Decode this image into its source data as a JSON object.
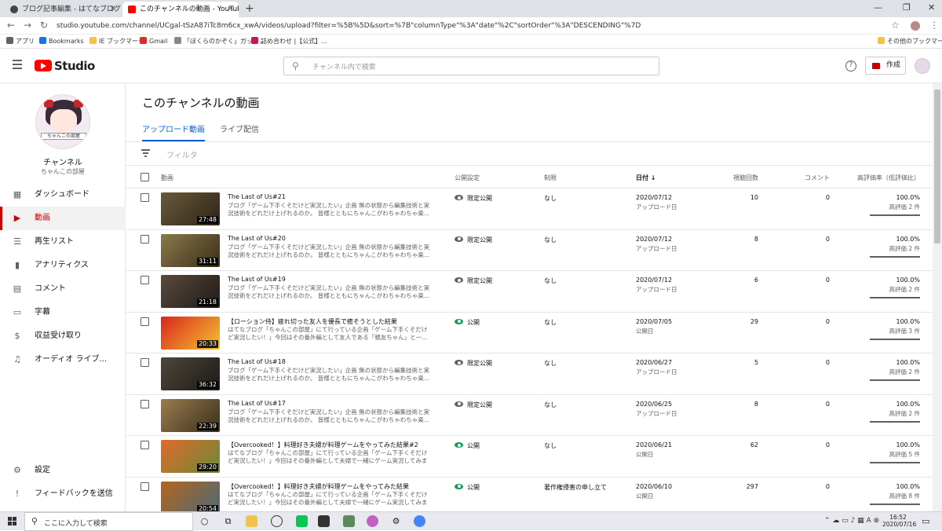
{
  "browser": {
    "tabs": [
      {
        "title": "ブログ記事編集 - はてなブログ"
      },
      {
        "title": "このチャンネルの動画 - YouTube Studio"
      }
    ],
    "url": "studio.youtube.com/channel/UCgal-tSzA87iTc8m6cx_xwA/videos/upload?filter=%5B%5D&sort=%7B\"columnType\"%3A\"date\"%2C\"sortOrder\"%3A\"DESCENDING\"%7D",
    "bookmarks": [
      "アプリ",
      "Bookmarks",
      "IE ブックマーク",
      "Gmail",
      "「ぼくらのかぞく」ガッチ...",
      "詰め合わせ |【公式】...",
      "その他のブックマーク"
    ]
  },
  "header": {
    "studio_label": "Studio",
    "search_placeholder": "チャンネル内で検索",
    "create_label": "作成",
    "help_glyph": "?"
  },
  "sidebar": {
    "channel_name": "チャンネル",
    "channel_sub": "ちゃんこの部屋",
    "avatar_band": "ちゃんこの部屋",
    "items": [
      {
        "label": "ダッシュボード",
        "icon": "dashboard-icon",
        "glyph": "▦"
      },
      {
        "label": "動画",
        "icon": "video-icon",
        "glyph": "▶"
      },
      {
        "label": "再生リスト",
        "icon": "playlist-icon",
        "glyph": "☰"
      },
      {
        "label": "アナリティクス",
        "icon": "analytics-icon",
        "glyph": "▮"
      },
      {
        "label": "コメント",
        "icon": "comment-icon",
        "glyph": "▤"
      },
      {
        "label": "字幕",
        "icon": "subtitles-icon",
        "glyph": "▭"
      },
      {
        "label": "収益受け取り",
        "icon": "dollar-icon",
        "glyph": "$"
      },
      {
        "label": "オーディオ ライブ...",
        "icon": "audio-library-icon",
        "glyph": "♫"
      }
    ],
    "settings_label": "設定",
    "feedback_label": "フィードバックを送信"
  },
  "main": {
    "page_title": "このチャンネルの動画",
    "tabs": [
      "アップロード動画",
      "ライブ配信"
    ],
    "filter_placeholder": "フィルタ",
    "columns": {
      "video": "動画",
      "visibility": "公開設定",
      "restrictions": "制限",
      "date": "日付",
      "views": "視聴回数",
      "comments": "コメント",
      "rating": "高評価率（低評価比）"
    },
    "accent_color": "#065fd4",
    "rows": [
      {
        "title": "The Last of Us#21",
        "desc": "ブログ「ゲーム下手くそだけど実況したい」企画 無の状態から編集技術と実況技術をどれだけ上げれるのか。 皆様とともにちゃんこがわちゃわちゃ楽...",
        "duration": "27:48",
        "visibility": "限定公開",
        "vis_color": "#606060",
        "restriction": "なし",
        "date": "2020/07/12",
        "date_sub": "アップロード日",
        "views": "10",
        "comments": "0",
        "rating": "100.0%",
        "rating_sub": "高評価 2 件",
        "thumb": [
          "#6b5a3a",
          "#2d2418"
        ]
      },
      {
        "title": "The Last of Us#20",
        "desc": "ブログ「ゲーム下手くそだけど実況したい」企画 無の状態から編集技術と実況技術をどれだけ上げれるのか。 皆様とともにちゃんこがわちゃわちゃ楽...",
        "duration": "31:11",
        "visibility": "限定公開",
        "vis_color": "#606060",
        "restriction": "なし",
        "date": "2020/07/12",
        "date_sub": "アップロード日",
        "views": "8",
        "comments": "0",
        "rating": "100.0%",
        "rating_sub": "高評価 2 件",
        "thumb": [
          "#8a7a4a",
          "#3a2e1a"
        ]
      },
      {
        "title": "The Last of Us#19",
        "desc": "ブログ「ゲーム下手くそだけど実況したい」企画 無の状態から編集技術と実況技術をどれだけ上げれるのか。 皆様とともにちゃんこがわちゃわちゃ楽...",
        "duration": "21:18",
        "visibility": "限定公開",
        "vis_color": "#606060",
        "restriction": "なし",
        "date": "2020/07/12",
        "date_sub": "アップロード日",
        "views": "6",
        "comments": "0",
        "rating": "100.0%",
        "rating_sub": "高評価 2 件",
        "thumb": [
          "#5a4a3e",
          "#1f1a16"
        ]
      },
      {
        "title": "【ローション侍】疲れ切った友人を優長で癒そうとした結果",
        "desc": "はてなブログ「ちゃんこの部屋」にて行っている企画「ゲーム下手くそだけど実況したい！」今回はその番外編として友人である「親友ちゃん」と一...",
        "duration": "20:33",
        "visibility": "公開",
        "vis_color": "#0f9d58",
        "restriction": "なし",
        "date": "2020/07/05",
        "date_sub": "公開日",
        "views": "29",
        "comments": "0",
        "rating": "100.0%",
        "rating_sub": "高評価 3 件",
        "thumb": [
          "#d9261c",
          "#f4c430"
        ]
      },
      {
        "title": "The Last of Us#18",
        "desc": "ブログ「ゲーム下手くそだけど実況したい」企画 無の状態から編集技術と実況技術をどれだけ上げれるのか。 皆様とともにちゃんこがわちゃわちゃ楽...",
        "duration": "36:32",
        "visibility": "限定公開",
        "vis_color": "#606060",
        "restriction": "なし",
        "date": "2020/06/27",
        "date_sub": "アップロード日",
        "views": "5",
        "comments": "0",
        "rating": "100.0%",
        "rating_sub": "高評価 2 件",
        "thumb": [
          "#4e463a",
          "#1c1a16"
        ]
      },
      {
        "title": "The Last of Us#17",
        "desc": "ブログ「ゲーム下手くそだけど実況したい」企画 無の状態から編集技術と実況技術をどれだけ上げれるのか。 皆様とともにちゃんこがわちゃわちゃ楽...",
        "duration": "22:39",
        "visibility": "限定公開",
        "vis_color": "#606060",
        "restriction": "なし",
        "date": "2020/06/25",
        "date_sub": "アップロード日",
        "views": "8",
        "comments": "0",
        "rating": "100.0%",
        "rating_sub": "高評価 2 件",
        "thumb": [
          "#9a7d4e",
          "#3b2f1d"
        ]
      },
      {
        "title": "【Overcooked！】料理好き夫婦が料理ゲームをやってみた結果#2",
        "desc": "はてなブログ「ちゃんこの部屋」にて行っている企画「ゲーム下手くそだけど実況したい！」今回はその番外編として夫婦で一緒にゲーム実況してみまし...",
        "duration": "29:20",
        "visibility": "公開",
        "vis_color": "#0f9d58",
        "restriction": "なし",
        "date": "2020/06/21",
        "date_sub": "公開日",
        "views": "62",
        "comments": "0",
        "rating": "100.0%",
        "rating_sub": "高評価 5 件",
        "thumb": [
          "#e06a2a",
          "#6a8a3a"
        ]
      },
      {
        "title": "【Overcooked！】料理好き夫婦が料理ゲームをやってみた結果",
        "desc": "はてなブログ「ちゃんこの部屋」にて行っている企画「ゲーム下手くそだけど実況したい！」今回はその番外編として夫婦で一緒にゲーム実況してみまし...",
        "duration": "20:54",
        "visibility": "公開",
        "vis_color": "#0f9d58",
        "restriction": "著作権侵害の申し立て",
        "date": "2020/06/10",
        "date_sub": "公開日",
        "views": "297",
        "comments": "0",
        "rating": "100.0%",
        "rating_sub": "高評価 8 件",
        "thumb": [
          "#b5651d",
          "#4a6a7a"
        ]
      }
    ]
  },
  "taskbar": {
    "search_placeholder": "ここに入力して検索",
    "time": "16:52",
    "date": "2020/07/16"
  }
}
